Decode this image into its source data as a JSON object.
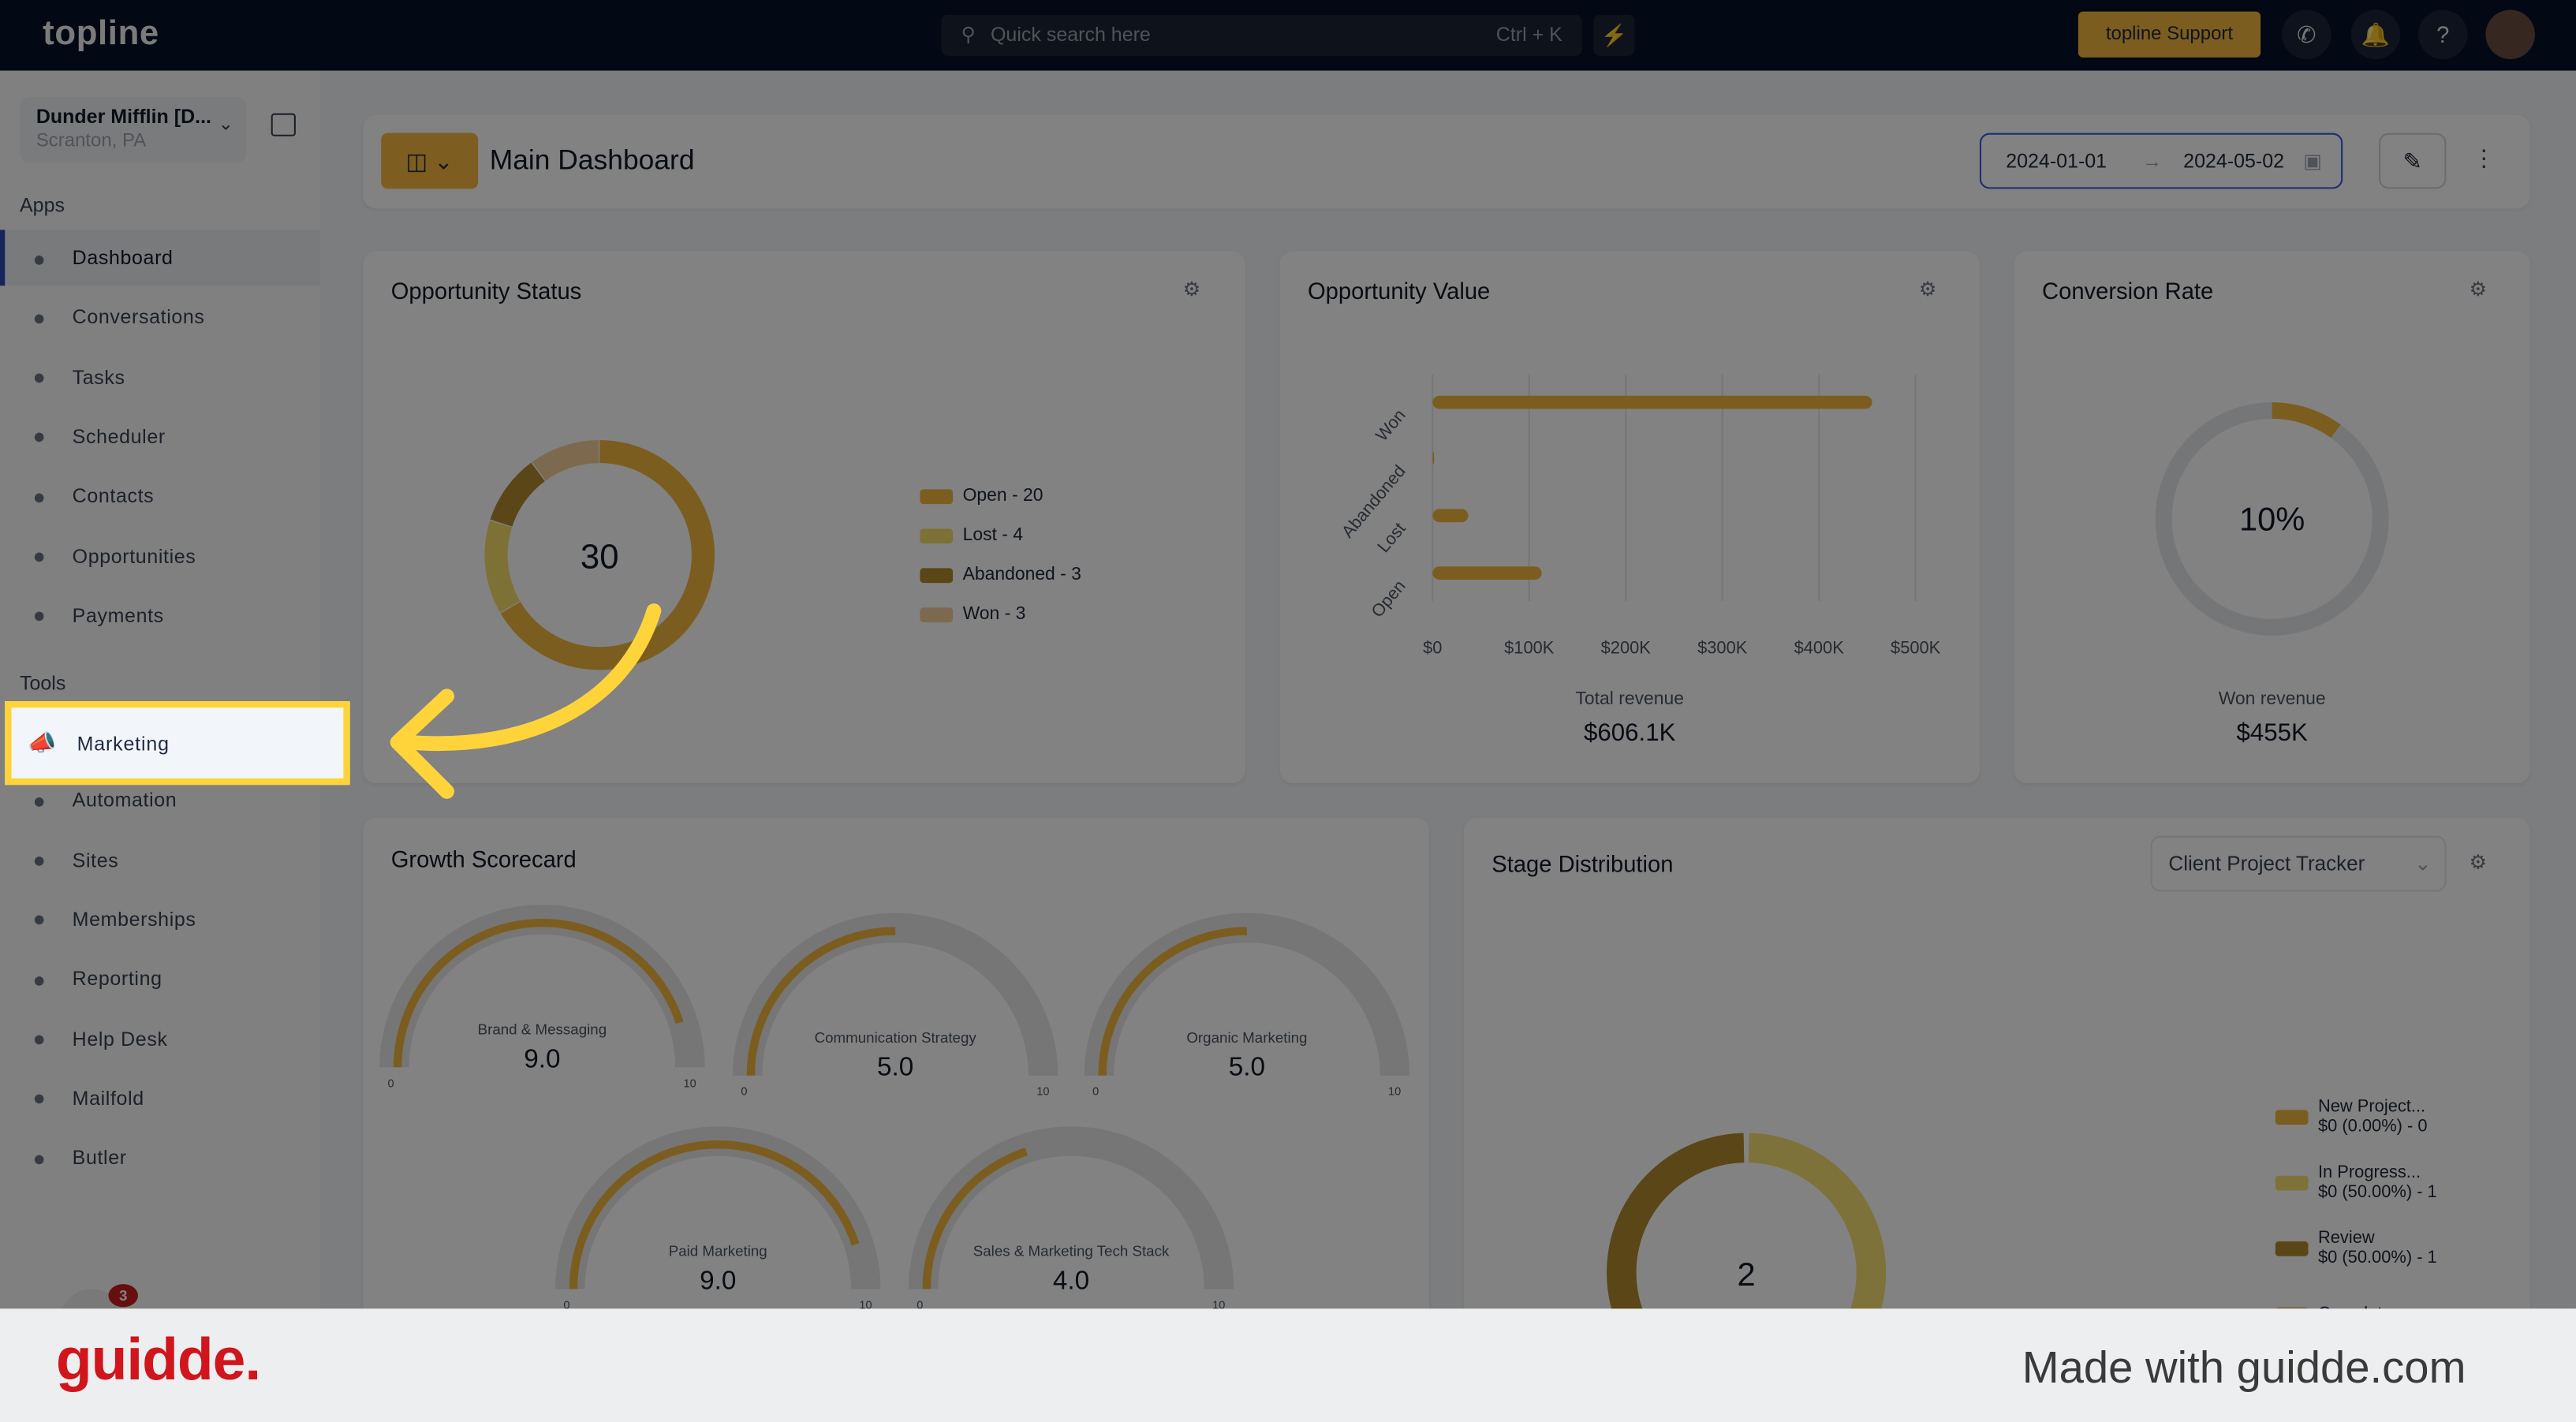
{
  "header": {
    "logo": "topline",
    "search_placeholder": "Quick search here",
    "search_shortcut": "Ctrl + K",
    "support_label": "topline Support"
  },
  "account": {
    "name": "Dunder Mifflin [D...",
    "location": "Scranton, PA"
  },
  "sidebar": {
    "apps_label": "Apps",
    "apps": [
      {
        "label": "Dashboard",
        "icon": "dashboard-icon"
      },
      {
        "label": "Conversations",
        "icon": "chat-icon"
      },
      {
        "label": "Tasks",
        "icon": "tasks-icon"
      },
      {
        "label": "Scheduler",
        "icon": "calendar-icon"
      },
      {
        "label": "Contacts",
        "icon": "contact-icon"
      },
      {
        "label": "Opportunities",
        "icon": "target-icon"
      },
      {
        "label": "Payments",
        "icon": "card-icon"
      }
    ],
    "tools_label": "Tools",
    "tools": [
      {
        "label": "Marketing",
        "icon": "megaphone-icon"
      },
      {
        "label": "Automation",
        "icon": "gears-icon"
      },
      {
        "label": "Sites",
        "icon": "globe-icon"
      },
      {
        "label": "Memberships",
        "icon": "members-icon"
      },
      {
        "label": "Reporting",
        "icon": "pie-icon"
      },
      {
        "label": "Help Desk",
        "icon": "help-icon"
      },
      {
        "label": "Mailfold",
        "icon": "mail-icon"
      },
      {
        "label": "Butler",
        "icon": "bell-service-icon"
      }
    ],
    "badge_count": "3"
  },
  "dashboard": {
    "title": "Main Dashboard",
    "date_from": "2024-01-01",
    "date_to": "2024-05-02"
  },
  "opportunity_status": {
    "title": "Opportunity Status",
    "total": "30"
  },
  "opportunity_value": {
    "title": "Opportunity Value",
    "total_label": "Total revenue",
    "total": "$606.1K"
  },
  "conversion_rate": {
    "title": "Conversion Rate",
    "value": "10%",
    "sub_label": "Won revenue",
    "sub_value": "$455K"
  },
  "growth_scorecard": {
    "title": "Growth Scorecard"
  },
  "stage_distribution": {
    "title": "Stage Distribution",
    "pipeline": "Client Project Tracker",
    "total": "2",
    "legend": [
      {
        "name": "New Project...",
        "detail": "$0 (0.00%) - 0",
        "color": "#f0b640"
      },
      {
        "name": "In Progress...",
        "detail": "$0 (50.00%) - 1",
        "color": "#f5e070"
      },
      {
        "name": "Review",
        "detail": "$0 (50.00%) - 1",
        "color": "#b08a2c"
      },
      {
        "name": "Complete",
        "detail": "",
        "color": "#f5cf9a"
      }
    ]
  },
  "chart_data": [
    {
      "type": "pie",
      "title": "Opportunity Status",
      "categories": [
        "Open",
        "Lost",
        "Abandoned",
        "Won"
      ],
      "values": [
        20,
        4,
        3,
        3
      ],
      "legend": [
        "Open - 20",
        "Lost - 4",
        "Abandoned - 3",
        "Won - 3"
      ],
      "colors": [
        "#f3b740",
        "#f5dd6a",
        "#b08a2c",
        "#f5cf9a"
      ],
      "legend_position": "right"
    },
    {
      "type": "bar",
      "orientation": "horizontal",
      "title": "Opportunity Value",
      "categories": [
        "Won",
        "Abandoned",
        "Lost",
        "Open"
      ],
      "values": [
        455000,
        0,
        37000,
        113000
      ],
      "xlim": [
        0,
        500000
      ],
      "xticks": [
        "$0",
        "$100K",
        "$200K",
        "$300K",
        "$400K",
        "$500K"
      ],
      "grid": true,
      "color": "#f3b740"
    },
    {
      "type": "pie",
      "title": "Conversion Rate",
      "values": [
        10,
        90
      ],
      "color": "#f3b740"
    },
    {
      "type": "gauge",
      "title": "Growth Scorecard",
      "range": [
        0,
        10
      ],
      "min_label": "0",
      "max_label": "10",
      "series": [
        {
          "name": "Brand & Messaging",
          "value": 9.0,
          "label": "9.0"
        },
        {
          "name": "Communication Strategy",
          "value": 5.0,
          "label": "5.0"
        },
        {
          "name": "Organic Marketing",
          "value": 5.0,
          "label": "5.0"
        },
        {
          "name": "Paid Marketing",
          "value": 9.0,
          "label": "9.0"
        },
        {
          "name": "Sales & Marketing Tech Stack",
          "value": 4.0,
          "label": "4.0"
        }
      ],
      "color": "#f3b740"
    },
    {
      "type": "pie",
      "title": "Stage Distribution",
      "categories": [
        "New Project...",
        "In Progress...",
        "Review",
        "Complete"
      ],
      "values": [
        0,
        1,
        1,
        0
      ]
    }
  ],
  "footer": {
    "brand": "guidde.",
    "tagline": "Made with guidde.com"
  }
}
